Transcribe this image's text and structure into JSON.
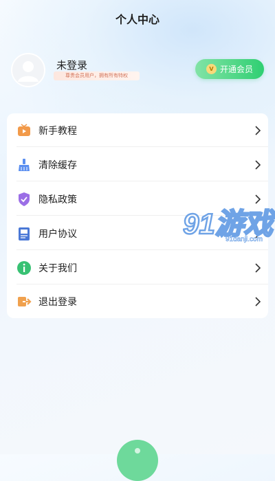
{
  "header": {
    "title": "个人中心"
  },
  "profile": {
    "login_status": "未登录",
    "member_tip": "尊贵会员用户，拥有所有特权",
    "vip_button_label": "开通会员",
    "vip_badge": "V"
  },
  "menu": {
    "items": [
      {
        "label": "新手教程",
        "icon": "tv-icon"
      },
      {
        "label": "清除缓存",
        "icon": "broom-icon"
      },
      {
        "label": "隐私政策",
        "icon": "shield-icon"
      },
      {
        "label": "用户协议",
        "icon": "document-icon"
      },
      {
        "label": "关于我们",
        "icon": "info-icon"
      },
      {
        "label": "退出登录",
        "icon": "logout-icon"
      }
    ]
  },
  "watermark": {
    "brand": "91游戏",
    "site": "91danji.com"
  },
  "colors": {
    "accent_green": "#2fcf72",
    "tv_orange": "#f29a4a",
    "broom_blue": "#5b8ff0",
    "shield_purple": "#9b6ee6",
    "doc_blue": "#4a78d6",
    "info_green": "#38c173",
    "logout_orange": "#f0a14e"
  }
}
